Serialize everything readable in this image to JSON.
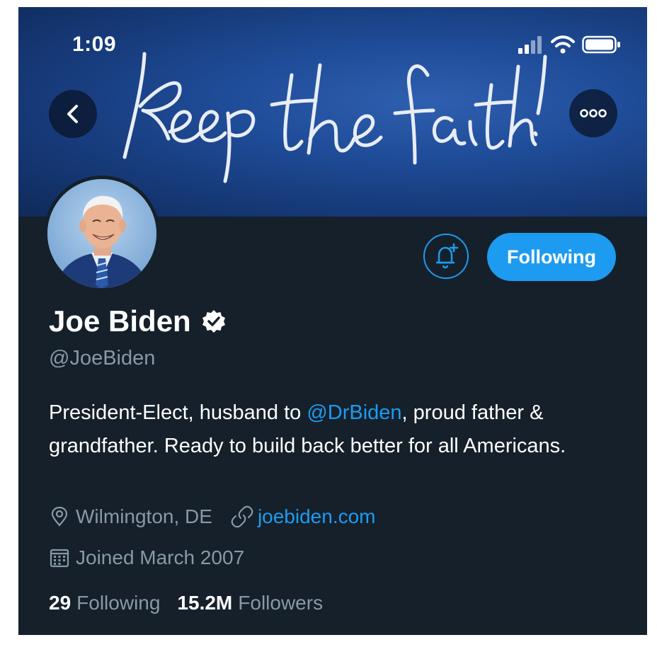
{
  "status_bar": {
    "time": "1:09"
  },
  "header": {
    "banner_text": "keep the faith!"
  },
  "profile": {
    "follow_button_label": "Following",
    "name": "Joe Biden",
    "handle": "@JoeBiden",
    "bio": {
      "part1": "President-Elect, husband to ",
      "mention": "@DrBiden",
      "part2": ", proud father & grandfather. Ready to build back better for all Americans."
    },
    "location": "Wilmington, DE",
    "website": "joebiden.com",
    "joined": "Joined March 2007",
    "following_count": "29",
    "following_label": "Following",
    "followers_count": "15.2M",
    "followers_label": "Followers"
  },
  "colors": {
    "accent": "#1d9bf0",
    "background": "#15202b",
    "secondary_text": "#8899a6"
  }
}
